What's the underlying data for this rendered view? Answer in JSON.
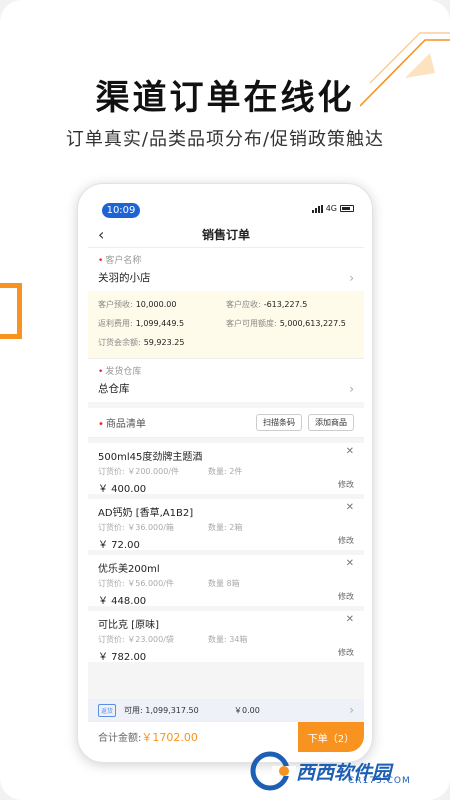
{
  "headline": "渠道订单在线化",
  "subline": "订单真实/品类品项分布/促销政策触达",
  "status": {
    "time": "10:09",
    "network": "4G"
  },
  "nav": {
    "back_icon": "chevron-left-icon",
    "title": "销售订单"
  },
  "customer": {
    "label": "客户名称",
    "value": "关羽的小店"
  },
  "credit": {
    "prepaid_label": "客户预收:",
    "prepaid_value": "10,000.00",
    "receivable_label": "客户应收:",
    "receivable_value": "-613,227.5",
    "rebate_label": "返利费用:",
    "rebate_value": "1,099,449.5",
    "available_label": "客户可用额度:",
    "available_value": "5,000,613,227.5",
    "balance_label": "订货会余额:",
    "balance_value": "59,923.25"
  },
  "warehouse": {
    "label": "发货仓库",
    "value": "总仓库"
  },
  "goods": {
    "label": "商品清单",
    "scan_button": "扫描条码",
    "add_button": "添加商品",
    "items": [
      {
        "name": "500ml45度劲牌主题酒",
        "unit_price": "订货价: ￥200.000/件",
        "qty": "数量: 2件",
        "total": "￥ 400.00",
        "edit": "修改"
      },
      {
        "name": "AD钙奶 [香草,A1B2]",
        "unit_price": "订货价: ￥36.000/箱",
        "qty": "数量: 2箱",
        "total": "￥ 72.00",
        "edit": "修改"
      },
      {
        "name": "优乐美200ml",
        "unit_price": "订货价: ￥56.000/件",
        "qty": "数量  8箱",
        "total": "￥ 448.00",
        "edit": "修改"
      },
      {
        "name": "可比克 [原味]",
        "unit_price": "订货价: ￥23.000/袋",
        "qty": "数量: 34箱",
        "total": "￥ 782.00",
        "edit": "修改"
      }
    ]
  },
  "summary": {
    "tag": "返货",
    "available": "可用: 1,099,317.50",
    "amount": "￥0.00"
  },
  "footer": {
    "total_label": "合计金额:",
    "total_value": "￥1702.00",
    "submit": "下单（2）"
  },
  "watermark": {
    "brand": "西西软件园",
    "domain": "CR173.COM"
  },
  "colors": {
    "accent": "#f7931e",
    "time_pill": "#1e63d6"
  }
}
